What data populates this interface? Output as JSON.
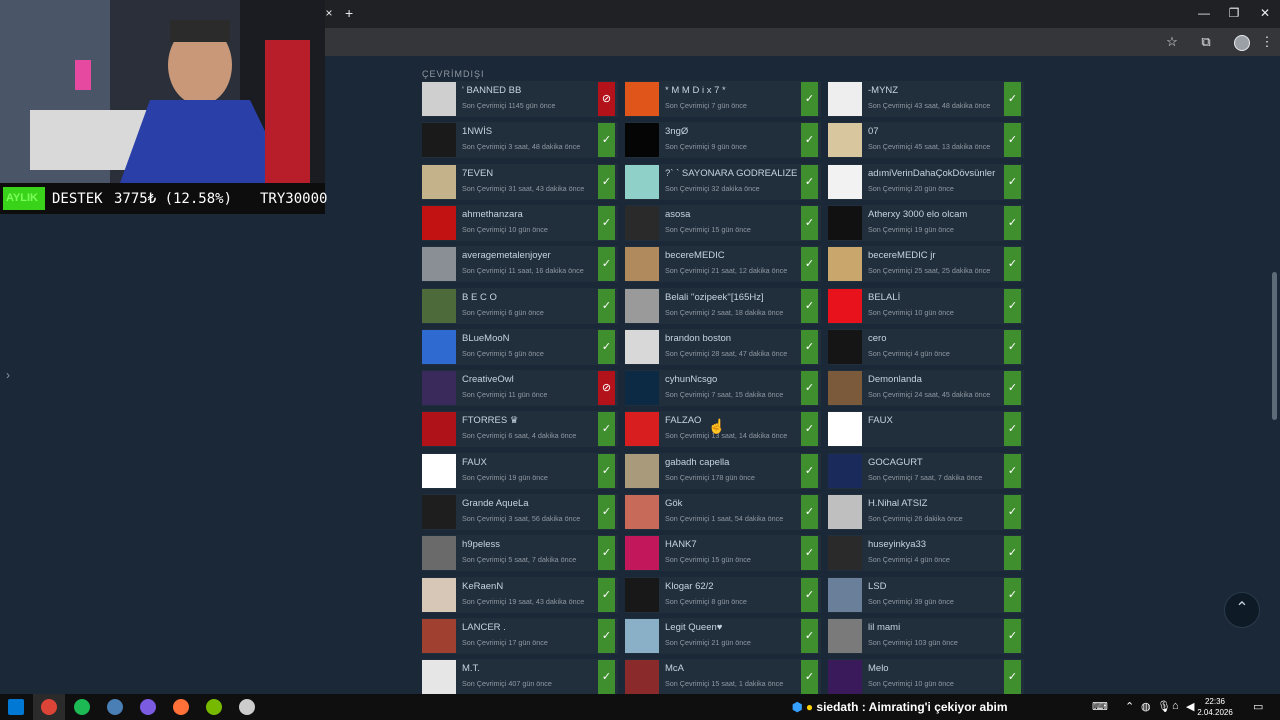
{
  "browser": {
    "tab_close": "×",
    "new_tab": "+",
    "window_controls": [
      "—",
      "❐",
      "✕"
    ],
    "toolbar_icons": [
      "☆",
      "⧉",
      "⋮"
    ]
  },
  "page": {
    "section_title": "ÇEVRİMDIŞI",
    "left_arrow": "›",
    "scroll_top_icon": "⌃"
  },
  "friends": [
    {
      "name": "' BANNED BB",
      "status": "Son Çevrimiçi 1145 gün önce",
      "state": "blocked",
      "avatar": "#cfcfcf"
    },
    {
      "name": "* M M D i x 7 *",
      "status": "Son Çevrimiçi 7 gün önce",
      "state": "ok",
      "avatar": "#e0561a"
    },
    {
      "name": "-MYNZ",
      "status": "Son Çevrimiçi 43 saat, 48 dakika önce",
      "state": "ok",
      "avatar": "#eeeeee"
    },
    {
      "name": "1NWİS",
      "status": "Son Çevrimiçi 3 saat, 48 dakika önce",
      "state": "ok",
      "avatar": "#1a1a1a"
    },
    {
      "name": "3ngØ",
      "status": "Son Çevrimiçi 9 gün önce",
      "state": "ok",
      "avatar": "#050505"
    },
    {
      "name": "07",
      "status": "Son Çevrimiçi 45 saat, 13 dakika önce",
      "state": "ok",
      "avatar": "#d8c79e"
    },
    {
      "name": "7EVEN",
      "status": "Son Çevrimiçi 31 saat, 43 dakika önce",
      "state": "ok",
      "avatar": "#c4b28a"
    },
    {
      "name": "?` ` SAYONARA GODREALIZE",
      "status": "Son Çevrimiçi 32 dakika önce",
      "state": "ok",
      "avatar": "#8fd1c9"
    },
    {
      "name": "adımiVerinDahaÇokDövsünler",
      "status": "Son Çevrimiçi 20 gün önce",
      "state": "ok",
      "avatar": "#f2f2f2"
    },
    {
      "name": "ahmethanzara",
      "status": "Son Çevrimiçi 10 gün önce",
      "state": "ok",
      "avatar": "#c21212"
    },
    {
      "name": "asosa",
      "status": "Son Çevrimiçi 15 gün önce",
      "state": "ok",
      "avatar": "#2a2a2a"
    },
    {
      "name": "Atherxy 3000 elo olcam",
      "status": "Son Çevrimiçi 19 gün önce",
      "state": "ok",
      "avatar": "#111111"
    },
    {
      "name": "averagemetalenjoyer",
      "status": "Son Çevrimiçi 11 saat, 16 dakika önce",
      "state": "ok",
      "avatar": "#8a8f96"
    },
    {
      "name": "becereMEDIC",
      "status": "Son Çevrimiçi 21 saat, 12 dakika önce",
      "state": "ok",
      "avatar": "#b08a5c"
    },
    {
      "name": "becereMEDIC jr",
      "status": "Son Çevrimiçi 25 saat, 25 dakika önce",
      "state": "ok",
      "avatar": "#c9a66b"
    },
    {
      "name": "B E C O",
      "status": "Son Çevrimiçi 6 gün önce",
      "state": "ok",
      "avatar": "#4d6b3a"
    },
    {
      "name": "Belali ''ozipeek''[165Hz]",
      "status": "Son Çevrimiçi 2 saat, 18 dakika önce",
      "state": "ok",
      "avatar": "#9a9a9a"
    },
    {
      "name": "BELALİ",
      "status": "Son Çevrimiçi 10 gün önce",
      "state": "ok",
      "avatar": "#e8121c"
    },
    {
      "name": "BLueMooN",
      "status": "Son Çevrimiçi 5 gün önce",
      "state": "ok",
      "avatar": "#2f6ad1"
    },
    {
      "name": "brandon boston",
      "status": "Son Çevrimiçi 28 saat, 47 dakika önce",
      "state": "ok",
      "avatar": "#d8d8d8"
    },
    {
      "name": "cero",
      "status": "Son Çevrimiçi 4 gün önce",
      "state": "ok",
      "avatar": "#151515"
    },
    {
      "name": "CreativeOwl",
      "status": "Son Çevrimiçi 11 gün önce",
      "state": "blocked",
      "avatar": "#3a2a5c"
    },
    {
      "name": "cyhunNcsgo",
      "status": "Son Çevrimiçi 7 saat, 15 dakika önce",
      "state": "ok",
      "avatar": "#0c2a44"
    },
    {
      "name": "Demonlanda",
      "status": "Son Çevrimiçi 24 saat, 45 dakika önce",
      "state": "ok",
      "avatar": "#7a5a3a"
    },
    {
      "name": "FTORRES ♛",
      "status": "Son Çevrimiçi 6 saat, 4 dakika önce",
      "state": "ok",
      "avatar": "#b0121a"
    },
    {
      "name": "FALZAO",
      "status": "Son Çevrimiçi 13 saat, 14 dakika önce",
      "state": "ok",
      "avatar": "#d81e1e"
    },
    {
      "name": "FAUX",
      "status": "",
      "state": "ok",
      "avatar": "#ffffff"
    },
    {
      "name": "FAUX",
      "status": "Son Çevrimiçi 19 gün önce",
      "state": "ok",
      "avatar": "#ffffff"
    },
    {
      "name": "gabadh capella",
      "status": "Son Çevrimiçi 178 gün önce",
      "state": "ok",
      "avatar": "#a89a7a"
    },
    {
      "name": "GOCAGURT",
      "status": "Son Çevrimiçi 7 saat, 7 dakika önce",
      "state": "ok",
      "avatar": "#1a2a5a"
    },
    {
      "name": "Grande AqueLa",
      "status": "Son Çevrimiçi 3 saat, 56 dakika önce",
      "state": "ok",
      "avatar": "#1e1e1e"
    },
    {
      "name": "Gök",
      "status": "Son Çevrimiçi 1 saat, 54 dakika önce",
      "state": "ok",
      "avatar": "#c86a5a"
    },
    {
      "name": "H.Nihal ATSIZ",
      "status": "Son Çevrimiçi 26 dakika önce",
      "state": "ok",
      "avatar": "#bfbfbf"
    },
    {
      "name": "h9peless",
      "status": "Son Çevrimiçi 5 saat, 7 dakika önce",
      "state": "ok",
      "avatar": "#6a6a6a"
    },
    {
      "name": "HANK7",
      "status": "Son Çevrimiçi 15 gün önce",
      "state": "ok",
      "avatar": "#c2185b"
    },
    {
      "name": "huseyinkya33",
      "status": "Son Çevrimiçi 4 gün önce",
      "state": "ok",
      "avatar": "#2a2a2a"
    },
    {
      "name": "KeRaenN",
      "status": "Son Çevrimiçi 19 saat, 43 dakika önce",
      "state": "ok",
      "avatar": "#d7c7b7"
    },
    {
      "name": "Klogar 62/2",
      "status": "Son Çevrimiçi 8 gün önce",
      "state": "ok",
      "avatar": "#181818"
    },
    {
      "name": "LSD",
      "status": "Son Çevrimiçi 39 gün önce",
      "state": "ok",
      "avatar": "#6a7f9a"
    },
    {
      "name": "LANCER .",
      "status": "Son Çevrimiçi 17 gün önce",
      "state": "ok",
      "avatar": "#a04030"
    },
    {
      "name": "Legit Queen♥",
      "status": "Son Çevrimiçi 21 gün önce",
      "state": "ok",
      "avatar": "#8ab0c8"
    },
    {
      "name": "lil mami",
      "status": "Son Çevrimiçi 103 gün önce",
      "state": "ok",
      "avatar": "#7a7a7a"
    },
    {
      "name": "M.T.",
      "status": "Son Çevrimiçi 407 gün önce",
      "state": "ok",
      "avatar": "#e6e6e6"
    },
    {
      "name": "McA",
      "status": "Son Çevrimiçi 15 saat, 1 dakika önce",
      "state": "ok",
      "avatar": "#8a2a2a"
    },
    {
      "name": "Melo",
      "status": "Son Çevrimiçi 10 gün önce",
      "state": "ok",
      "avatar": "#3a1a5a"
    }
  ],
  "overlay": {
    "bar_label": "AYLIK",
    "bar_title": "DESTEK",
    "bar_amount": "3775₺ (12.58%)",
    "bar_goal": "TRY30000",
    "progress_percent": 12.58
  },
  "taskbar": {
    "apps": [
      {
        "name": "windows-start-icon",
        "color": "#0078d4"
      },
      {
        "name": "chrome-icon",
        "color": "#db4437"
      },
      {
        "name": "spotify-icon",
        "color": "#1db954"
      },
      {
        "name": "steam-icon",
        "color": "#4a7fb5"
      },
      {
        "name": "discord-icon",
        "color": "#7b5ce1"
      },
      {
        "name": "firefox-icon",
        "color": "#ff7139"
      },
      {
        "name": "nvidia-icon",
        "color": "#76b900"
      },
      {
        "name": "clock-app-icon",
        "color": "#cccccc"
      }
    ],
    "ticker_user": "siedath",
    "ticker_text": ": Aimrating'i çekiyor abim",
    "time": "22:36",
    "date": "2.04.2026"
  }
}
